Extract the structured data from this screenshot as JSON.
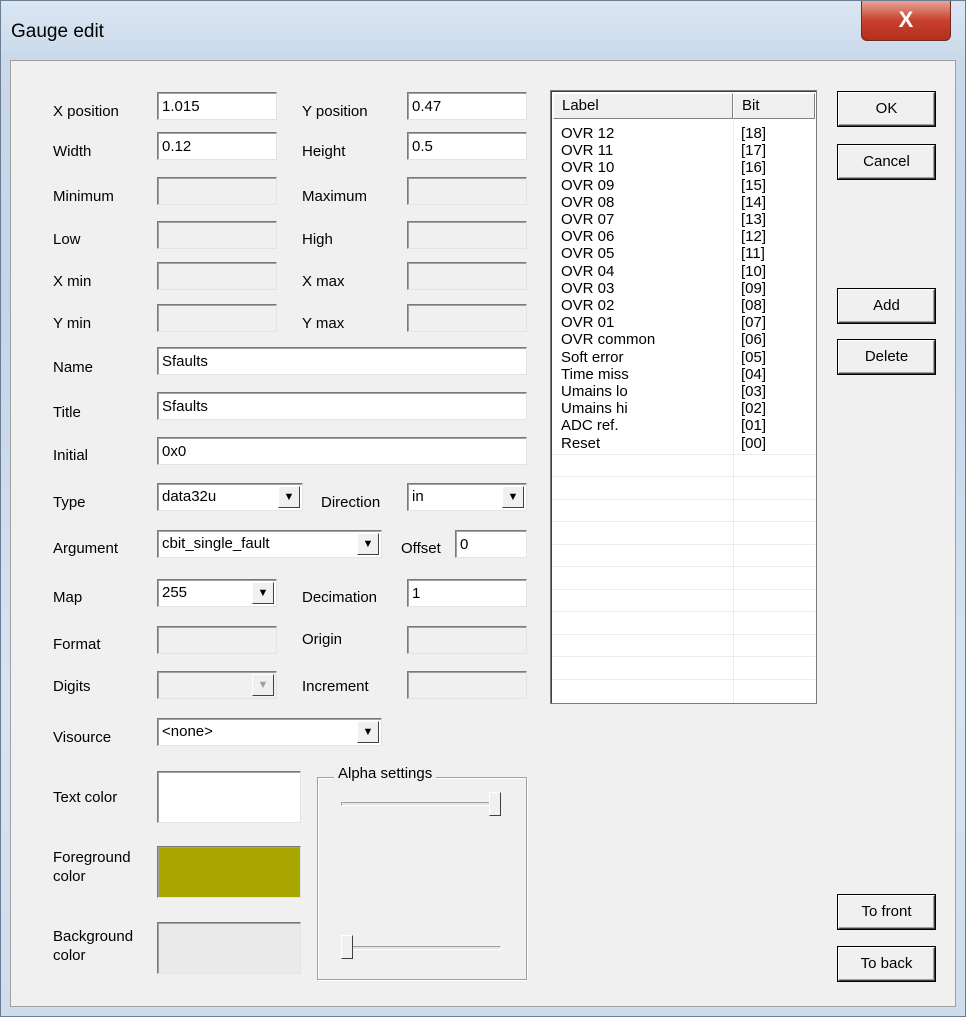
{
  "window": {
    "title": "Gauge edit",
    "close_label": "X"
  },
  "fields": {
    "x_position": {
      "label": "X position",
      "value": "1.015"
    },
    "y_position": {
      "label": "Y position",
      "value": "0.47"
    },
    "width": {
      "label": "Width",
      "value": "0.12"
    },
    "height": {
      "label": "Height",
      "value": "0.5"
    },
    "minimum": {
      "label": "Minimum",
      "value": ""
    },
    "maximum": {
      "label": "Maximum",
      "value": ""
    },
    "low": {
      "label": "Low",
      "value": ""
    },
    "high": {
      "label": "High",
      "value": ""
    },
    "x_min": {
      "label": "X min",
      "value": ""
    },
    "x_max": {
      "label": "X max",
      "value": ""
    },
    "y_min": {
      "label": "Y min",
      "value": ""
    },
    "y_max": {
      "label": "Y max",
      "value": ""
    },
    "name": {
      "label": "Name",
      "value": "Sfaults"
    },
    "title": {
      "label": "Title",
      "value": "Sfaults"
    },
    "initial": {
      "label": "Initial",
      "value": "0x0"
    },
    "type": {
      "label": "Type",
      "value": "data32u"
    },
    "direction": {
      "label": "Direction",
      "value": "in"
    },
    "argument": {
      "label": "Argument",
      "value": "cbit_single_fault"
    },
    "offset": {
      "label": "Offset",
      "value": "0"
    },
    "map": {
      "label": "Map",
      "value": "255"
    },
    "decimation": {
      "label": "Decimation",
      "value": "1"
    },
    "format": {
      "label": "Format",
      "value": ""
    },
    "origin": {
      "label": "Origin",
      "value": ""
    },
    "digits": {
      "label": "Digits",
      "value": ""
    },
    "increment": {
      "label": "Increment",
      "value": ""
    },
    "visource": {
      "label": "Visource",
      "value": "<none>"
    }
  },
  "colors": {
    "text_color_label": "Text color",
    "text_color": "#ffffff",
    "foreground_label_1": "Foreground",
    "foreground_label_2": "color",
    "foreground_color": "#aaa600",
    "background_label_1": "Background",
    "background_label_2": "color",
    "background_color": "#eaeaea"
  },
  "alpha": {
    "title": "Alpha settings",
    "top_slider_level": 1.0,
    "bottom_slider_level": 0.0
  },
  "bit_list": {
    "columns": [
      "Label",
      "Bit"
    ],
    "rows": [
      [
        "OVR 12",
        "[18]"
      ],
      [
        "OVR 11",
        "[17]"
      ],
      [
        "OVR 10",
        "[16]"
      ],
      [
        "OVR 09",
        "[15]"
      ],
      [
        "OVR 08",
        "[14]"
      ],
      [
        "OVR 07",
        "[13]"
      ],
      [
        "OVR 06",
        "[12]"
      ],
      [
        "OVR 05",
        "[11]"
      ],
      [
        "OVR 04",
        "[10]"
      ],
      [
        "OVR 03",
        "[09]"
      ],
      [
        "OVR 02",
        "[08]"
      ],
      [
        "OVR 01",
        "[07]"
      ],
      [
        "OVR common",
        "[06]"
      ],
      [
        "Soft error",
        "[05]"
      ],
      [
        "Time miss",
        "[04]"
      ],
      [
        "Umains lo",
        "[03]"
      ],
      [
        "Umains hi",
        "[02]"
      ],
      [
        "ADC ref.",
        "[01]"
      ],
      [
        "Reset",
        "[00]"
      ]
    ]
  },
  "buttons": {
    "ok": "OK",
    "cancel": "Cancel",
    "add": "Add",
    "delete": "Delete",
    "to_front": "To front",
    "to_back": "To back"
  },
  "icons": {
    "dropdown": "chevron-down-icon",
    "close": "close-icon"
  }
}
